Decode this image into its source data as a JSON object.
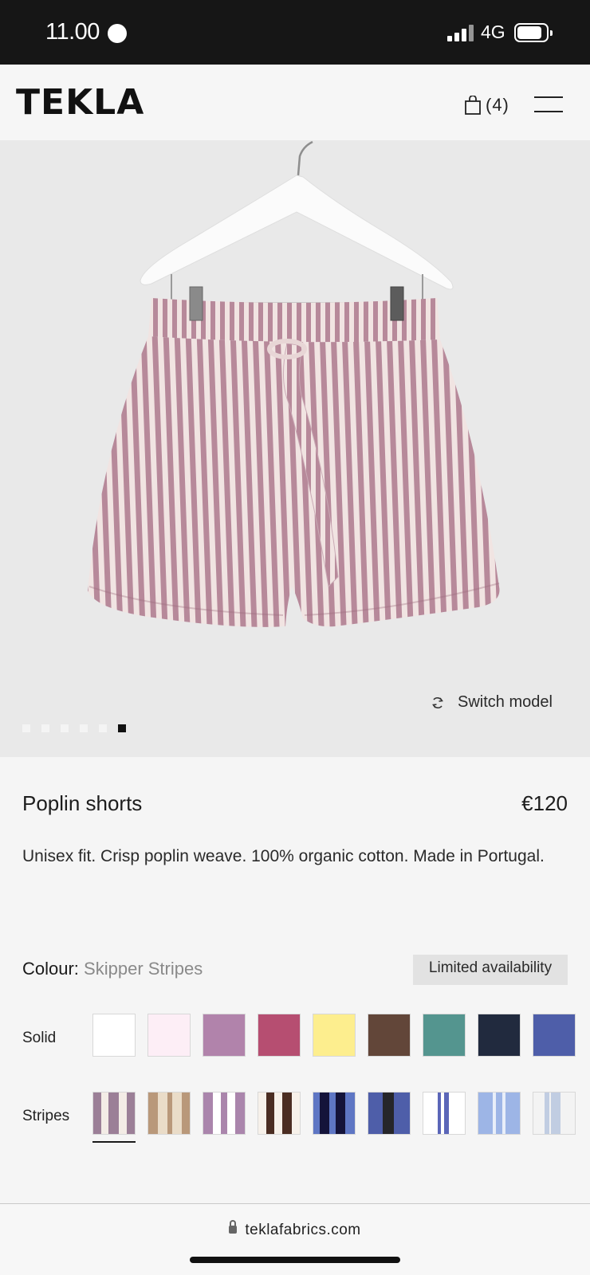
{
  "status_bar": {
    "time": "11.00",
    "network": "4G"
  },
  "header": {
    "logo": "TEKLA",
    "cart_count": "(4)"
  },
  "gallery": {
    "switch_model_label": "Switch model",
    "total_images": 6,
    "active_index": 5
  },
  "product": {
    "name": "Poplin shorts",
    "price": "€120",
    "description": "Unisex fit. Crisp poplin weave. 100% organic cotton. Made in Portugal."
  },
  "colour": {
    "label": "Colour:",
    "value": "Skipper Stripes",
    "availability": "Limited availability"
  },
  "swatches": {
    "solid_label": "Solid",
    "stripes_label": "Stripes",
    "solid": [
      {
        "name": "white",
        "color": "#ffffff"
      },
      {
        "name": "pale-pink",
        "color": "#fdeef6"
      },
      {
        "name": "mauve",
        "color": "#b183ab"
      },
      {
        "name": "raspberry",
        "color": "#b64e71"
      },
      {
        "name": "yellow",
        "color": "#fdee8e"
      },
      {
        "name": "brown",
        "color": "#624639"
      },
      {
        "name": "teal",
        "color": "#54958f"
      },
      {
        "name": "navy",
        "color": "#212a3e"
      },
      {
        "name": "blue",
        "color": "#4e5ea9"
      }
    ],
    "stripes": [
      {
        "name": "skipper-stripes",
        "base": "#f3ece6",
        "stripe": "#9b7f97",
        "selected": true
      },
      {
        "name": "hopper-stripes",
        "base": "#eadcc8",
        "stripe": "#b9987a"
      },
      {
        "name": "purple-pin-stripes",
        "base": "#ffffff",
        "stripe": "#aa85ac"
      },
      {
        "name": "dark-brown-stripes",
        "base": "#f7f1ea",
        "stripe": "#4b2d22"
      },
      {
        "name": "midnight-stripes",
        "base": "#5e76c4",
        "stripe": "#14133a"
      },
      {
        "name": "blue-black-stripes",
        "base": "#4e5ea9",
        "stripe": "#26262a"
      },
      {
        "name": "white-blue-stripes",
        "base": "#ffffff",
        "stripe": "#5b66b8"
      },
      {
        "name": "light-blue-stripes",
        "base": "#9db5e6",
        "stripe": "#e8eef9"
      },
      {
        "name": "pale-blue-stripes",
        "base": "#f3f3f3",
        "stripe": "#c1cde2"
      }
    ]
  },
  "browser": {
    "url": "teklafabrics.com"
  }
}
